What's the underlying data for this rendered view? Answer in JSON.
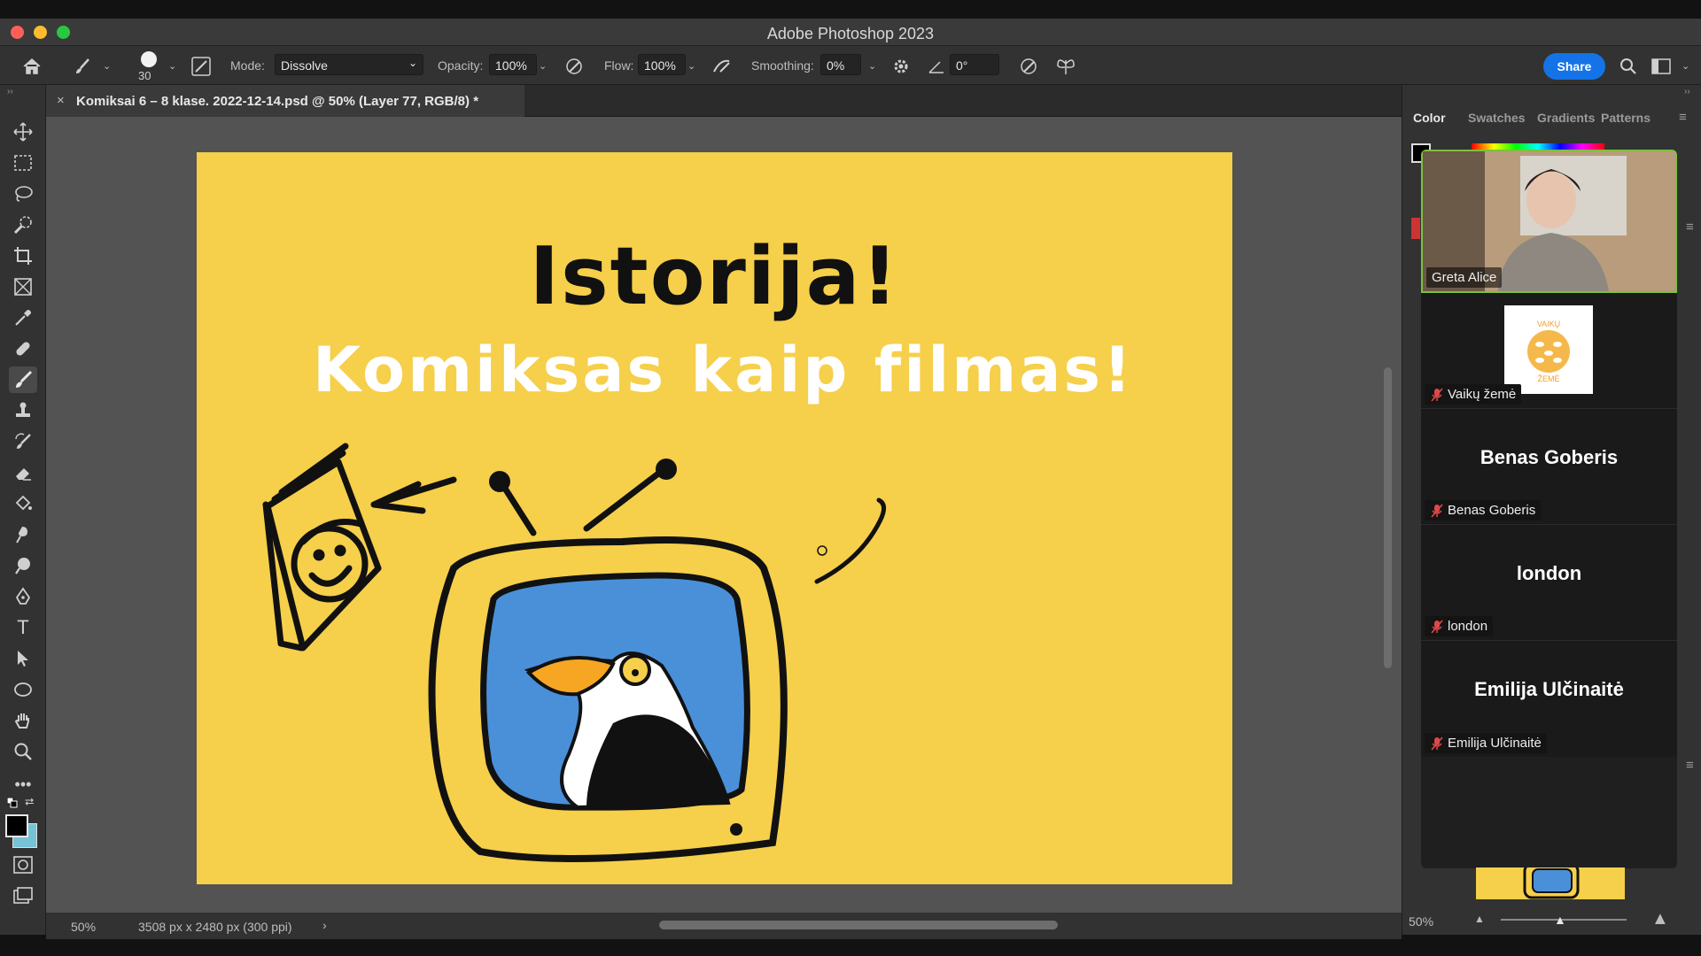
{
  "window": {
    "title": "Adobe Photoshop 2023"
  },
  "options_bar": {
    "brush_size": "30",
    "mode_label": "Mode:",
    "mode_value": "Dissolve",
    "opacity_label": "Opacity:",
    "opacity_value": "100%",
    "flow_label": "Flow:",
    "flow_value": "100%",
    "smoothing_label": "Smoothing:",
    "smoothing_value": "0%",
    "angle_value": "0°",
    "share_label": "Share"
  },
  "document_tab": {
    "title": "Komiksai 6 – 8 klase. 2022-12-14.psd @ 50% (Layer 77, RGB/8) *"
  },
  "artboard": {
    "heading": "Istorija!",
    "subheading": "Komiksas kaip filmas!"
  },
  "status_bar": {
    "zoom": "50%",
    "doc_info": "3508 px x 2480 px (300 ppi)"
  },
  "right_panel": {
    "tabs": [
      "Color",
      "Swatches",
      "Gradients",
      "Patterns"
    ],
    "zoom_value": "50%"
  },
  "meeting": {
    "participants": [
      {
        "name": "Greta Alice",
        "video": true
      },
      {
        "name": "Vaikų žemė",
        "logo": true,
        "logo_text_top": "VAIKŲ",
        "logo_text_bottom": "ŽEMĖ"
      },
      {
        "name": "Benas Goberis",
        "display": "Benas Goberis"
      },
      {
        "name": "london",
        "display": "london"
      },
      {
        "name": "Emilija Ulčinaitė",
        "display": "Emilija Ulčinaitė"
      }
    ]
  },
  "colors": {
    "artboard_bg": "#f6cf4b",
    "tv_screen": "#4a90d9",
    "share_button": "#1473e6",
    "mute_icon": "#e04848"
  }
}
